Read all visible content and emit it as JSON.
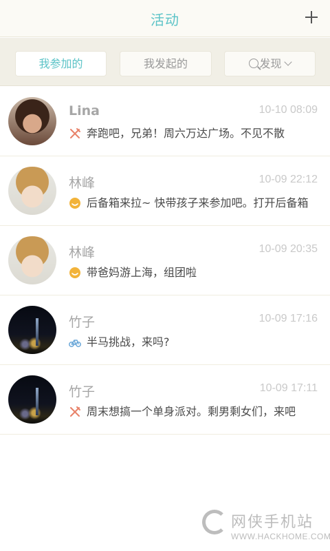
{
  "header": {
    "title": "活动",
    "add_icon": "plus-icon"
  },
  "segments": [
    {
      "label": "我参加的",
      "active": true
    },
    {
      "label": "我发起的",
      "active": false
    },
    {
      "label": "发现",
      "active": false,
      "icon": "search-icon",
      "trailing_icon": "chevron-down-icon"
    }
  ],
  "colors": {
    "accent": "#5bc3c7",
    "fork_icon": "#e8826a",
    "smile_icon": "#f2b33a",
    "bike_icon": "#6aa7d8"
  },
  "activities": [
    {
      "name": "Lina",
      "time": "10-10 08:09",
      "icon": "fork-knife-icon",
      "message": "奔跑吧，兄弟！周六万达广场。不见不散"
    },
    {
      "name": "林峰",
      "time": "10-09 22:12",
      "icon": "smile-icon",
      "message": "后备箱来拉~ 快带孩子来参加吧。打开后备箱"
    },
    {
      "name": "林峰",
      "time": "10-09 20:35",
      "icon": "smile-icon",
      "message": "带爸妈游上海，组团啦"
    },
    {
      "name": "竹子",
      "time": "10-09 17:16",
      "icon": "bicycle-icon",
      "message": "半马挑战，来吗?"
    },
    {
      "name": "竹子",
      "time": "10-09 17:11",
      "icon": "fork-knife-icon",
      "message": "周末想搞一个单身派对。剩男剩女们，来吧"
    }
  ],
  "watermark": {
    "cn": "网侠手机站",
    "en": "WWW.HACKHOME.COM"
  }
}
